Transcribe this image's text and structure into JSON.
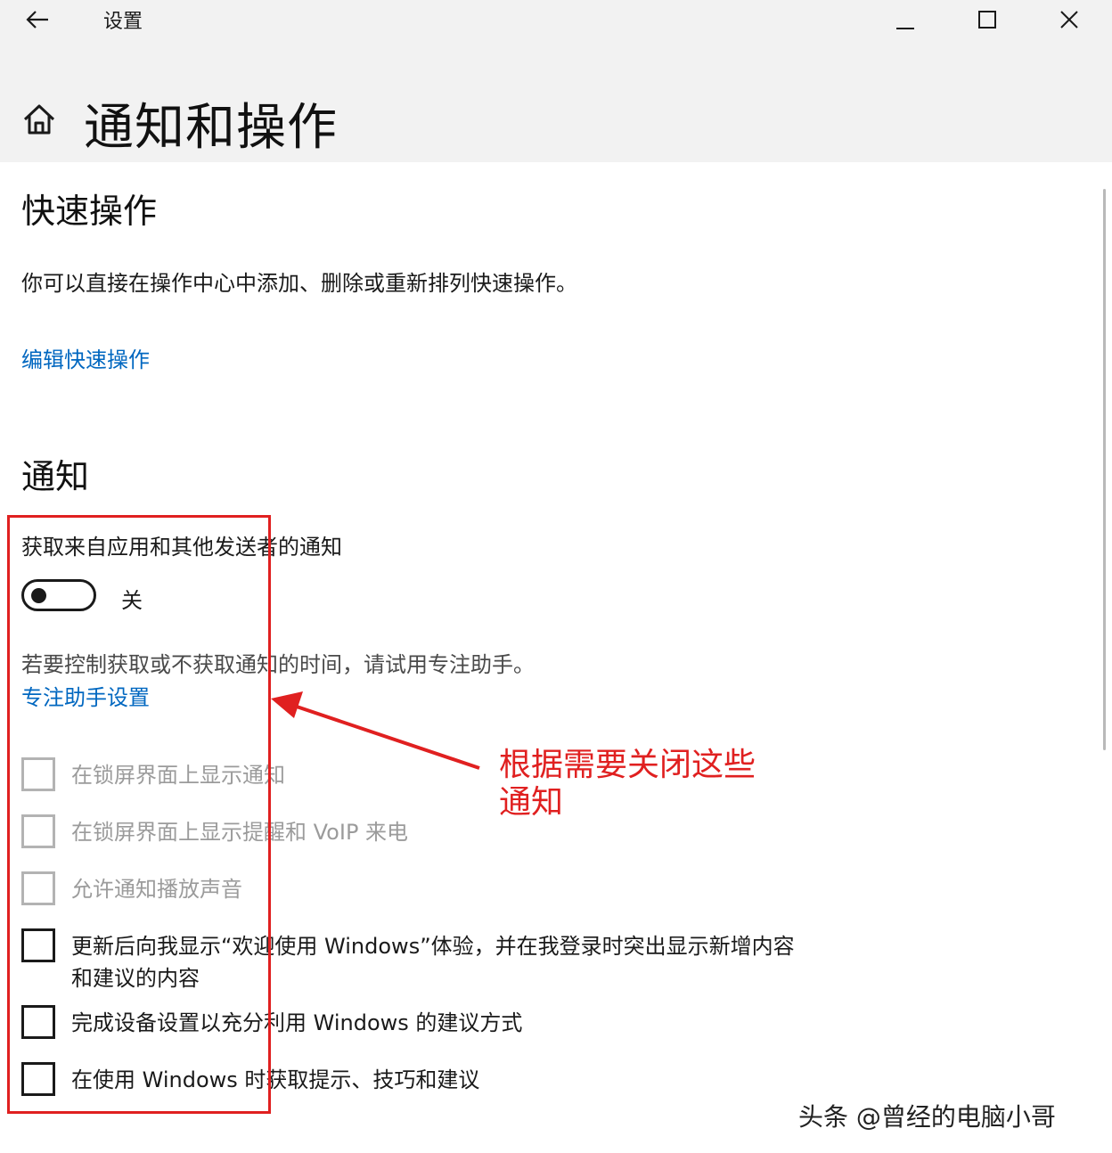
{
  "window": {
    "title": "设置",
    "controls": {
      "minimize": "minimize-icon",
      "maximize": "maximize-icon",
      "close": "close-icon"
    }
  },
  "page": {
    "title": "通知和操作"
  },
  "quick_actions": {
    "heading": "快速操作",
    "description": "你可以直接在操作中心中添加、删除或重新排列快速操作。",
    "edit_link": "编辑快速操作"
  },
  "notifications": {
    "heading": "通知",
    "get_label": "获取来自应用和其他发送者的通知",
    "toggle_state": "关",
    "hint": "若要控制获取或不获取通知的时间，请试用专注助手。",
    "focus_link": "专注助手设置",
    "options": [
      {
        "label": "在锁屏界面上显示通知",
        "checked": false,
        "enabled": false
      },
      {
        "label": "在锁屏界面上显示提醒和 VoIP 来电",
        "checked": false,
        "enabled": false
      },
      {
        "label": "允许通知播放声音",
        "checked": false,
        "enabled": false
      },
      {
        "label": "更新后向我显示“欢迎使用 Windows”体验，并在我登录时突出显示新增内容和建议的内容",
        "checked": false,
        "enabled": true
      },
      {
        "label": "完成设备设置以充分利用 Windows 的建议方式",
        "checked": false,
        "enabled": true
      },
      {
        "label": "在使用 Windows 时获取提示、技巧和建议",
        "checked": false,
        "enabled": true
      }
    ]
  },
  "annotation": {
    "text": "根据需要关闭这些通知",
    "color": "#e02020"
  },
  "watermark": "头条 @曾经的电脑小哥",
  "colors": {
    "accent": "#0067c0",
    "annotation": "#e02020",
    "titlebar": "#f2f2f2"
  }
}
